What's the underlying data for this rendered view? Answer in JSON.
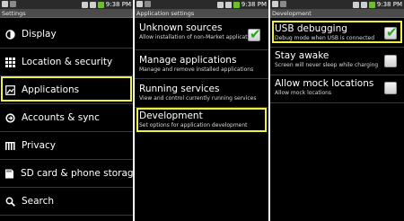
{
  "status": {
    "time": "9:38 PM"
  },
  "panel1": {
    "title": "Settings",
    "items": [
      {
        "label": "Display",
        "icon": "display-icon"
      },
      {
        "label": "Location & security",
        "icon": "location-grid-icon"
      },
      {
        "label": "Applications",
        "icon": "applications-icon"
      },
      {
        "label": "Accounts & sync",
        "icon": "sync-icon"
      },
      {
        "label": "Privacy",
        "icon": "privacy-icon"
      },
      {
        "label": "SD card & phone storage",
        "icon": "sd-card-icon"
      },
      {
        "label": "Search",
        "icon": "search-icon"
      }
    ],
    "highlighted": "Applications"
  },
  "panel2": {
    "title": "Application settings",
    "items": [
      {
        "title": "Unknown sources",
        "summary": "Allow installation of non-Market applications",
        "checked": true
      },
      {
        "title": "Manage applications",
        "summary": "Manage and remove installed applications"
      },
      {
        "title": "Running services",
        "summary": "View and control currently running services"
      },
      {
        "title": "Development",
        "summary": "Set options for application development"
      }
    ],
    "highlighted": "Development"
  },
  "panel3": {
    "title": "Development",
    "items": [
      {
        "title": "USB debugging",
        "summary": "Debug mode when USB is connected",
        "checked": true
      },
      {
        "title": "Stay awake",
        "summary": "Screen will never sleep while charging",
        "checked": false
      },
      {
        "title": "Allow mock locations",
        "summary": "Allow mock locations",
        "checked": false
      }
    ],
    "highlighted": "USB debugging"
  },
  "colors": {
    "highlight": "#f0f040",
    "titlebar": "#4b4b4b",
    "check": "#2aa42a"
  }
}
